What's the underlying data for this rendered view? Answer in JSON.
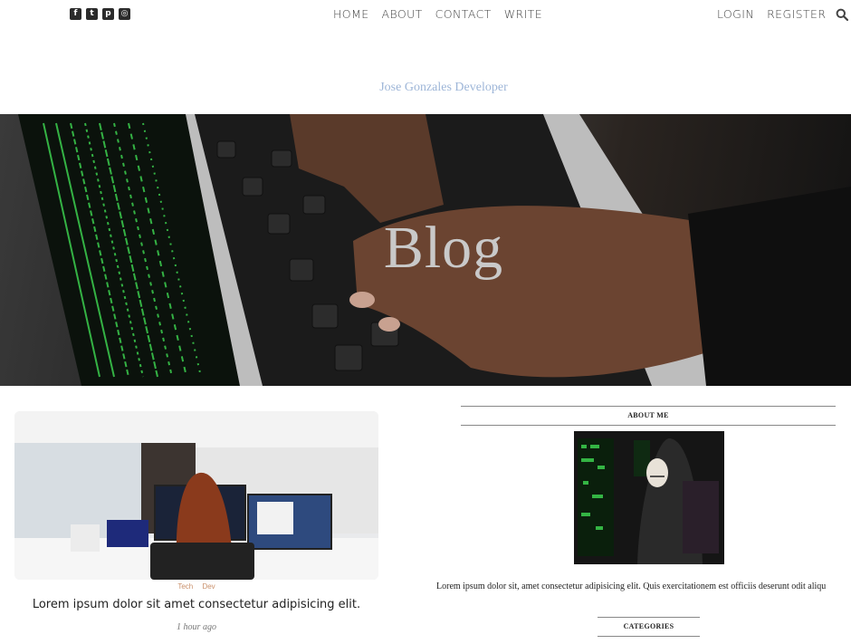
{
  "nav": {
    "social": [
      {
        "icon": "facebook-icon",
        "glyph": "f"
      },
      {
        "icon": "twitter-icon",
        "glyph": "t"
      },
      {
        "icon": "pinterest-icon",
        "glyph": "p"
      },
      {
        "icon": "instagram-icon",
        "glyph": "◎"
      }
    ],
    "links": [
      "HOME",
      "ABOUT",
      "CONTACT",
      "WRITE"
    ],
    "login": "LOGIN",
    "register": "REGISTER",
    "search_icon": "search-icon"
  },
  "header": {
    "site_name": "Jose Gonzales Developer",
    "hero_title": "Blog"
  },
  "post": {
    "tags": [
      "Tech",
      "Dev"
    ],
    "title": "Lorem ipsum dolor sit amet consectetur adipisicing elit.",
    "time": "1 hour ago"
  },
  "sidebar": {
    "about_title": "ABOUT ME",
    "about_text": "Lorem ipsum dolor sit, amet consectetur adipisicing elit. Quis exercitationem est officiis deserunt odit aliqu",
    "categories_title": "CATEGORIES"
  },
  "colors": {
    "site_name": "#9eb6d8",
    "tag": "#c9906b",
    "code_green": "#3ccf4e"
  }
}
